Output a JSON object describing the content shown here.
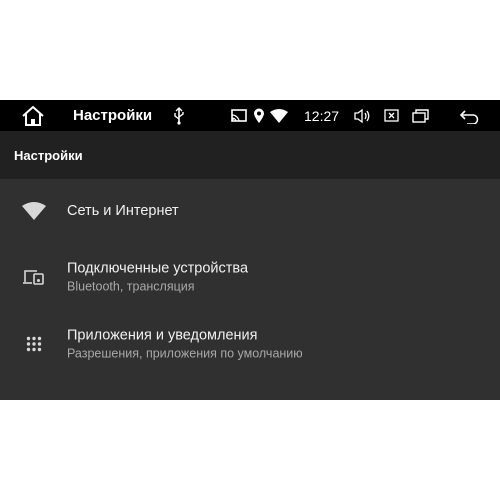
{
  "status_bar": {
    "app_title": "Настройки",
    "time": "12:27",
    "icons": [
      "home-icon",
      "usb-icon",
      "cast-icon",
      "location-icon",
      "wifi-icon",
      "volume-icon",
      "close-box-icon",
      "recents-icon",
      "back-icon"
    ]
  },
  "app_bar": {
    "title": "Настройки"
  },
  "settings_items": [
    {
      "title": "Сеть и Интернет",
      "summary": "",
      "icon": "wifi-icon"
    },
    {
      "title": "Подключенные устройства",
      "summary": "Bluetooth, трансляция",
      "icon": "devices-icon"
    },
    {
      "title": "Приложения и уведомления",
      "summary": "Разрешения, приложения по умолчанию",
      "icon": "apps-icon"
    }
  ],
  "colors": {
    "status_bar": "#000000",
    "app_bar": "#212121",
    "background": "#303030",
    "text_primary": "#f0f0f0",
    "text_secondary": "#a8a8a8"
  }
}
